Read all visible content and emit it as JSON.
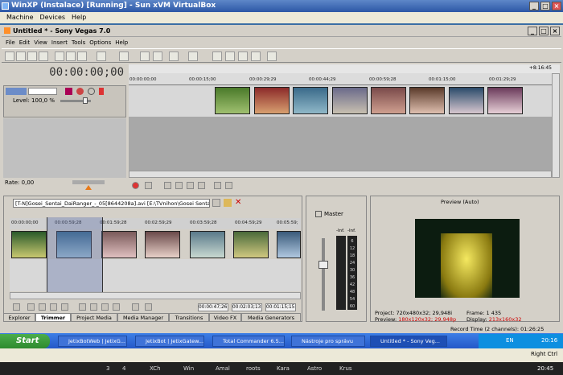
{
  "vbox": {
    "title": "WinXP (Instalace) [Running] - Sun xVM VirtualBox",
    "menu": [
      "Machine",
      "Devices",
      "Help"
    ]
  },
  "vegas": {
    "title": "Untitled * - Sony Vegas 7.0",
    "menu": [
      "File",
      "Edit",
      "View",
      "Insert",
      "Tools",
      "Options",
      "Help"
    ],
    "timecode": "00:00:00;00",
    "level": "Level: 100,0 %",
    "rate": "Rate: 0,00",
    "ruler_ticks": [
      "00:00:00;00",
      "00:00:15;00",
      "00:00:29;29",
      "00:00:44;29",
      "00:00:59;28",
      "00:01:15;00",
      "00:01:29;29"
    ],
    "ruler_right": "+8:16:45"
  },
  "trimmer": {
    "file": "[T-N]Gosei_Sentai_DaiRanger_-_05[8644208a].avi",
    "path": "[E:\\TVnihon\\Gosei Sentai -",
    "ruler": [
      "00:00:00;00",
      "00:00:59;28",
      "00:01:59;28",
      "00:02:59;29",
      "00:03:59;28",
      "00:04:59;29",
      "00:05:59;"
    ],
    "time_start": "00:00:47;26",
    "time_end": "00:02:03;13",
    "time_len": "00:01:15;15"
  },
  "tabs": [
    "Explorer",
    "Trimmer",
    "Project Media",
    "Media Manager",
    "Transitions",
    "Video FX",
    "Media Generators"
  ],
  "mixer": {
    "label": "Master",
    "left_top": "-Inf.",
    "right_top": "-Inf.",
    "scale": [
      "6",
      "12",
      "18",
      "24",
      "30",
      "36",
      "42",
      "48",
      "54",
      "60"
    ]
  },
  "preview": {
    "mode": "Preview (Auto)",
    "project_label": "Project:",
    "project": "720x480x32; 29,948i",
    "preview_label": "Preview:",
    "preview_val": "180x120x32; 29,948p",
    "frame_label": "Frame:",
    "frame": "1 435",
    "display_label": "Display:",
    "display": "213x160x32"
  },
  "record_time": "Record Time (2 channels): 01:26:25",
  "taskbar": {
    "start": "Start",
    "items": [
      "JetixBotWeb | JetixG...",
      "JetixBot | JetixGatew...",
      "Total Commander 6.5...",
      "Nástroje pro správu",
      "Untitled * - Sony Veg..."
    ],
    "lang": "EN",
    "clock": "20:16"
  },
  "host": {
    "right_ctrl": "Right Ctrl",
    "items": [
      "3",
      "4",
      "XCh",
      "Win",
      "Amal",
      "roots",
      "Kara",
      "Astro",
      "Krus"
    ],
    "clock": "20:45"
  }
}
